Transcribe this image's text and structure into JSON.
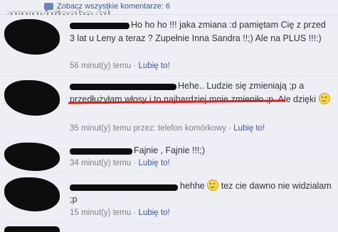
{
  "header": {
    "view_all_link": "Zobacz wszystkie komentarze: 6",
    "watermark": "www.wiocha.pl"
  },
  "comments": [
    {
      "text": "Ho ho ho !!! jaka zmiana :d pamiętam Cię z przed 3 lat u Leny a teraz ? Zupełnie Inna Sandra !!;) Ale na PLUS !!!:)",
      "time": "56 minut(y) temu",
      "separator": "·",
      "like": "Lubię to!"
    },
    {
      "text_a": "Hehe.. Ludzie się zmieniają ;p a ",
      "text_b": "przedłużyłam włosy i to najbardziej mnie zmieniło",
      "text_c": ";p. Ale dzięki",
      "time": "35 minut(y) temu przez: telefon komórkowy",
      "separator": "·",
      "like": "Lubię to!"
    },
    {
      "text": "Fajnie , Fajnie !!!;)",
      "time": "34 minut(y) temu",
      "separator": "·",
      "like": "Lubię to!"
    },
    {
      "text_a": "hehhe",
      "text_b": "tez cie dawno nie widzialam ;p",
      "time": "15 minut(y) temu",
      "separator": "·",
      "like": "Lubię to!"
    }
  ]
}
